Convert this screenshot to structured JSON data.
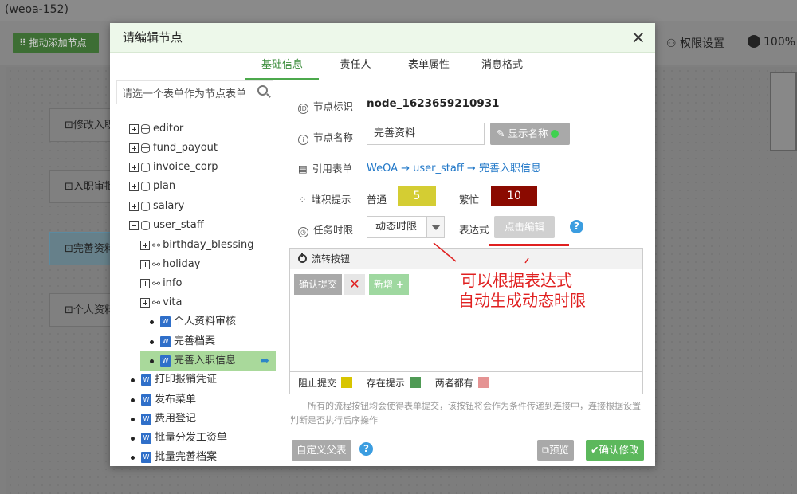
{
  "window": {
    "title": "(weoa-152)"
  },
  "toolbar": {
    "drag_add_label": "拖动添加节点",
    "permission_label": "权限设置",
    "zoom_label": "100%"
  },
  "canvas_nodes": [
    {
      "label": "修改入职"
    },
    {
      "label": "入职审批"
    },
    {
      "label": "完善资料"
    },
    {
      "label": "个人资料"
    }
  ],
  "modal": {
    "title": "请编辑节点",
    "close": "×",
    "tabs": [
      "基础信息",
      "责任人",
      "表单属性",
      "消息格式"
    ],
    "active_tab": "基础信息"
  },
  "tree": {
    "search_placeholder": "请选一个表单作为节点表单",
    "items": [
      {
        "label": "editor",
        "type": "db"
      },
      {
        "label": "fund_payout",
        "type": "db"
      },
      {
        "label": "invoice_corp",
        "type": "db"
      },
      {
        "label": "plan",
        "type": "db"
      },
      {
        "label": "salary",
        "type": "db"
      },
      {
        "label": "user_staff",
        "type": "db-open"
      },
      {
        "label": "birthday_blessing",
        "type": "share"
      },
      {
        "label": "holiday",
        "type": "share"
      },
      {
        "label": "info",
        "type": "share"
      },
      {
        "label": "vita",
        "type": "share"
      },
      {
        "label": "个人资料审核",
        "type": "form"
      },
      {
        "label": "完善档案",
        "type": "form"
      },
      {
        "label": "完善入职信息",
        "type": "form",
        "selected": true
      },
      {
        "label": "打印报销凭证",
        "type": "form"
      },
      {
        "label": "发布菜单",
        "type": "form"
      },
      {
        "label": "费用登记",
        "type": "form"
      },
      {
        "label": "批量分发工资单",
        "type": "form"
      },
      {
        "label": "批量完善档案",
        "type": "form"
      }
    ]
  },
  "form": {
    "node_id_label": "节点标识",
    "node_id_value": "node_1623659210931",
    "node_name_label": "节点名称",
    "node_name_value": "完善资料",
    "show_name_btn": "显示名称",
    "ref_form_label": "引用表单",
    "ref_form_value": "WeOA → user_staff → 完善入职信息",
    "backlog_label": "堆积提示",
    "normal_label": "普通",
    "normal_value": "5",
    "busy_label": "繁忙",
    "busy_value": "10",
    "time_limit_label": "任务时限",
    "time_limit_value": "动态时限",
    "expr_label": "表达式",
    "expr_btn": "点击编辑",
    "flow_buttons_title": "流转按钮",
    "confirm_submit": "确认提交",
    "add_new": "新增",
    "legend": [
      "阻止提交",
      "存在提示",
      "两者都有"
    ],
    "note": "所有的流程按钮均会使得表单提交，该按钮将会作为条件传递到连接中，连接根据设置判断是否执行后序操作",
    "custom_parent_btn": "自定义父表",
    "preview_btn": "预览",
    "confirm_btn": "确认修改"
  },
  "annotation": {
    "line1": "可以根据表达式",
    "line2": "自动生成动态时限"
  },
  "colors": {
    "accent": "#4ca94c",
    "normal": "#d4cd33",
    "busy": "#8b0a00",
    "legend": [
      "#d8c500",
      "#4f9a55",
      "#e59393"
    ],
    "annotation": "#e02020"
  }
}
